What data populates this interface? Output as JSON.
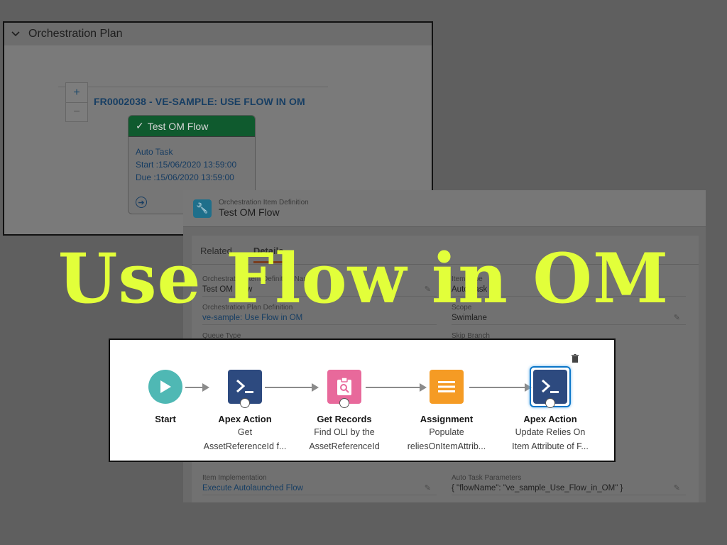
{
  "plan": {
    "header": "Orchestration Plan",
    "zoom_in": "+",
    "zoom_out": "−",
    "title": "FR0002038 - VE-SAMPLE: USE FLOW IN OM",
    "card": {
      "name": "Test OM Flow",
      "type": "Auto Task",
      "start": "Start :15/06/2020 13:59:00",
      "due": "Due :15/06/2020 13:59:00"
    }
  },
  "definition": {
    "subtitle": "Orchestration Item Definition",
    "name": "Test OM Flow",
    "tabs": [
      "Related",
      "Details"
    ],
    "fields": {
      "name_label": "Orchestration Item Definition Name",
      "name_value": "Test OM Flow",
      "type_label": "Item Type",
      "type_value": "Auto Task",
      "plan_label": "Orchestration Plan Definition",
      "plan_value": "ve-sample: Use Flow in OM",
      "scope_label": "Scope",
      "scope_value": "Swimlane",
      "queue_label": "Queue Type",
      "skip_label": "Skip Branch",
      "impl_label": "Item Implementation",
      "impl_value": "Execute Autolaunched Flow",
      "params_label": "Auto Task Parameters",
      "params_value": "{ \"flowName\": \"ve_sample_Use_Flow_in_OM\" }"
    }
  },
  "overlay": {
    "title": "Use Flow in OM"
  },
  "flow": {
    "nodes": [
      {
        "label": "Start",
        "desc1": "",
        "desc2": ""
      },
      {
        "label": "Apex Action",
        "desc1": "Get",
        "desc2": "AssetReferenceId f..."
      },
      {
        "label": "Get Records",
        "desc1": "Find OLI by the",
        "desc2": "AssetReferenceId"
      },
      {
        "label": "Assignment",
        "desc1": "Populate",
        "desc2": "reliesOnItemAttrib..."
      },
      {
        "label": "Apex Action",
        "desc1": "Update Relies On",
        "desc2": "Item Attribute of F..."
      }
    ]
  },
  "colors": {
    "overlay_text": "#e2ff3a",
    "start": "#4fb8b4",
    "apex": "#2d4a7f",
    "get_records": "#e8699b",
    "assignment": "#f59b24",
    "card_header": "#0f5a2e"
  }
}
